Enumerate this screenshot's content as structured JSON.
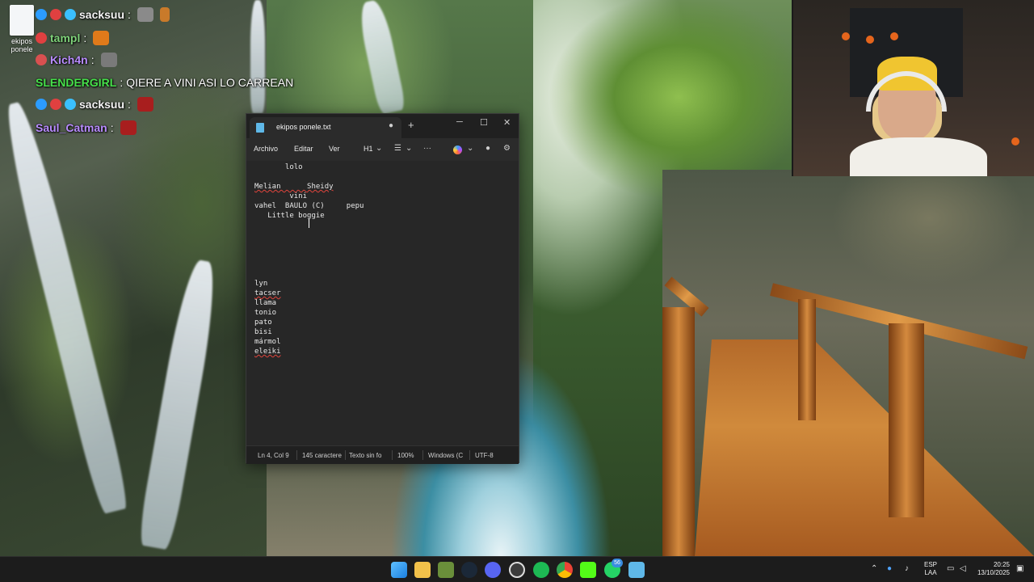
{
  "desktop": {
    "file_icon_label": "ekipos ponele"
  },
  "chat": [
    {
      "user": "sacksuu",
      "sep": ":",
      "message": ""
    },
    {
      "user": "tampl",
      "sep": ":",
      "message": ""
    },
    {
      "user": "Kich4n",
      "sep": ":",
      "message": ""
    },
    {
      "user": "SLENDERGIRL",
      "sep": ":",
      "message": "QIERE A VINI ASI LO CARREAN"
    },
    {
      "user": "sacksuu",
      "sep": ":",
      "message": ""
    },
    {
      "user": "Saul_Catman",
      "sep": ":",
      "message": ""
    }
  ],
  "chat_colors": {
    "sacksuu": "#f5f5f5",
    "tampl": "#7fd37a",
    "Kich4n": "#b98cff",
    "SLENDERGIRL": "#46e04a",
    "Saul_Catman": "#b98cff"
  },
  "notepad": {
    "tab_title": "ekipos ponele.txt",
    "tab_close": "●",
    "new_tab": "+",
    "window_controls": {
      "minimize": "─",
      "maximize": "☐",
      "close": "✕"
    },
    "menu": {
      "file": "Archivo",
      "edit": "Editar",
      "view": "Ver",
      "heading": "H1"
    },
    "lines": [
      "       lolo",
      "",
      "Melian      Sheidy",
      "        vini",
      "vahel  BAULO (C)     pepu",
      "   Little boggie",
      "",
      "",
      "",
      "",
      "",
      "",
      "lyn",
      "tacser",
      "llama",
      "tonio",
      "pato",
      "bisi",
      "mármol",
      "eleiki"
    ],
    "status": {
      "position": "Ln 4, Col 9",
      "chars": "145 caractere",
      "format": "Texto sin fo",
      "zoom": "100%",
      "line_ending": "Windows (C",
      "encoding": "UTF-8"
    }
  },
  "taskbar": {
    "whatsapp_badge": "56",
    "language_top": "ESP",
    "language_bottom": "LAA",
    "time": "20:25",
    "date": "13/10/2025"
  },
  "icons": {
    "notepad": "notepad-icon",
    "windows": "windows-start-icon",
    "folder": "file-explorer-icon",
    "steam": "steam-icon",
    "discord": "discord-icon",
    "spotify": "spotify-icon",
    "chrome": "chrome-icon",
    "kick": "kick-icon",
    "whatsapp": "whatsapp-icon"
  },
  "colors": {
    "editor_bg": "#272727",
    "accent": "#3a8de0",
    "spellcheck": "#e0443c"
  }
}
